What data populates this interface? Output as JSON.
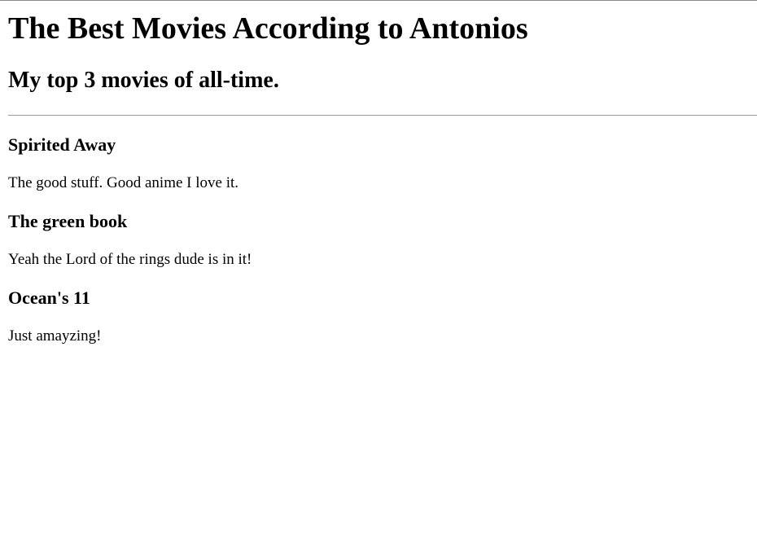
{
  "page": {
    "title": "The Best Movies According to Antonios",
    "subtitle": "My top 3 movies of all-time."
  },
  "movies": [
    {
      "title": "Spirited Away",
      "description": "The good stuff. Good anime I love it."
    },
    {
      "title": "The green book",
      "description": "Yeah the Lord of the rings dude is in it!"
    },
    {
      "title": "Ocean's 11",
      "description": "Just amayzing!"
    }
  ]
}
